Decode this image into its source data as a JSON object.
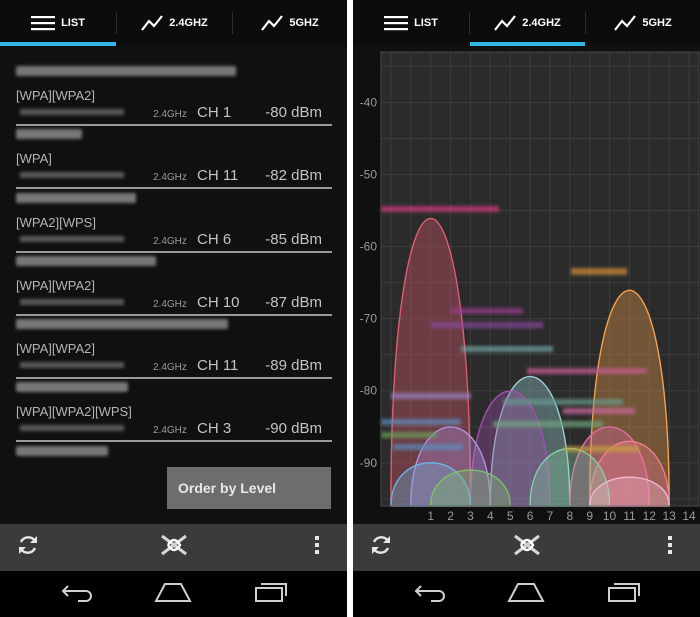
{
  "tabs": [
    {
      "label": "LIST"
    },
    {
      "label": "2.4GHZ"
    },
    {
      "label": "5GHZ"
    }
  ],
  "networks": [
    {
      "security": "[WPA][WPA2]",
      "band": "2.4GHz",
      "channel": "CH 1",
      "level": "-80 dBm"
    },
    {
      "security": "[WPA]",
      "band": "2.4GHz",
      "channel": "CH 11",
      "level": "-82 dBm"
    },
    {
      "security": "[WPA2][WPS]",
      "band": "2.4GHz",
      "channel": "CH 6",
      "level": "-85 dBm"
    },
    {
      "security": "[WPA][WPA2]",
      "band": "2.4GHz",
      "channel": "CH 10",
      "level": "-87 dBm"
    },
    {
      "security": "[WPA][WPA2]",
      "band": "2.4GHz",
      "channel": "CH 11",
      "level": "-89 dBm"
    },
    {
      "security": "[WPA][WPA2][WPS]",
      "band": "2.4GHz",
      "channel": "CH 3",
      "level": "-90 dBm"
    }
  ],
  "order_button": "Order by Level",
  "colors": {
    "accent": "#33b5e5",
    "background": "#101010",
    "action_bar": "#3b3b3b"
  },
  "icons": {
    "refresh": "refresh-icon",
    "app": "app-logo-icon",
    "overflow": "overflow-menu-icon",
    "back": "back-icon",
    "home": "home-icon",
    "recents": "recents-icon"
  },
  "chart_data": {
    "type": "area",
    "ylabel": "",
    "xlabel": "",
    "ylim": [
      -96,
      -33
    ],
    "xlim": [
      -1.5,
      14.5
    ],
    "y_ticks": [
      -40,
      -50,
      -60,
      -70,
      -80,
      -90
    ],
    "x_ticks": [
      "1",
      "2",
      "3",
      "4",
      "5",
      "6",
      "7",
      "8",
      "9",
      "10",
      "11",
      "12",
      "13",
      "14"
    ],
    "grid": true,
    "series": [
      {
        "channel": 1,
        "level": -56,
        "color": "#e15b70"
      },
      {
        "channel": 11,
        "level": -66,
        "color": "#f4a34b"
      },
      {
        "channel": 6,
        "level": -78,
        "color": "#9bd0d6"
      },
      {
        "channel": 5,
        "level": -80,
        "color": "#a44fb0"
      },
      {
        "channel": 2,
        "level": -85,
        "color": "#b58fe0"
      },
      {
        "channel": 10,
        "level": -85,
        "color": "#e26aa6"
      },
      {
        "channel": 11,
        "level": -87,
        "color": "#f07c8e"
      },
      {
        "channel": 8,
        "level": -88,
        "color": "#86d0a3"
      },
      {
        "channel": 1,
        "level": -90,
        "color": "#6bb3e0"
      },
      {
        "channel": 3,
        "level": -91,
        "color": "#7fbf6a"
      },
      {
        "channel": 11,
        "level": -92,
        "color": "#f2b5cf"
      }
    ]
  }
}
